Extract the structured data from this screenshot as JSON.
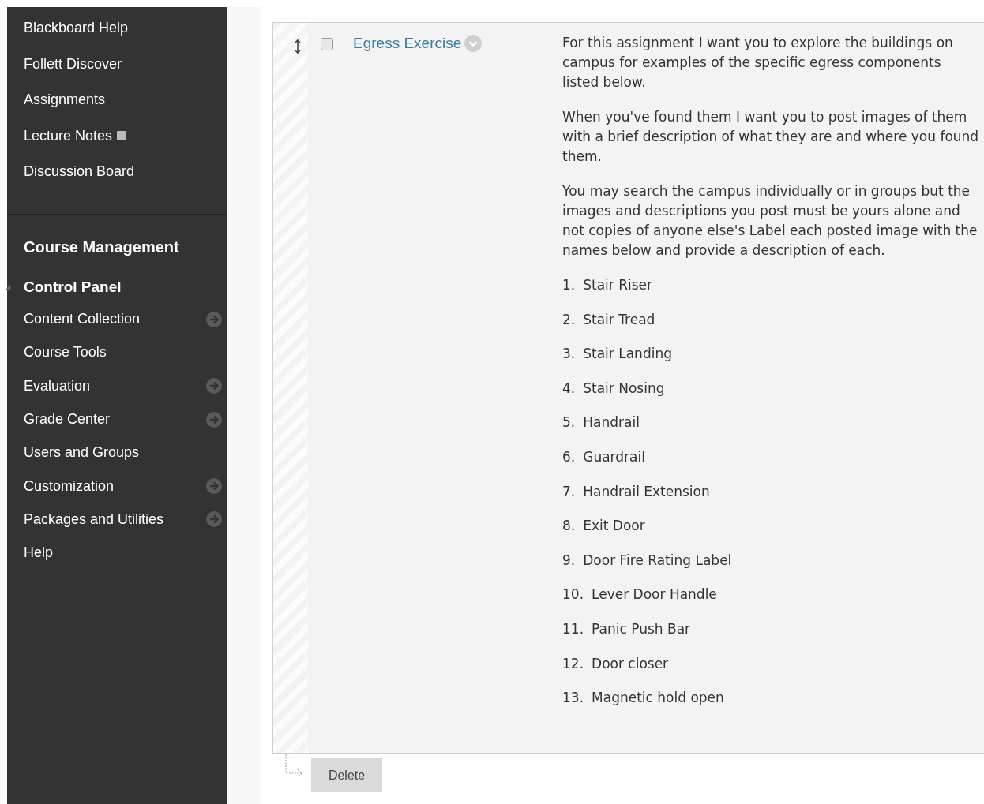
{
  "sidebar": {
    "course_menu": [
      {
        "label": "Blackboard Help",
        "has_icon": false
      },
      {
        "label": "Follett Discover",
        "has_icon": false
      },
      {
        "label": "Assignments",
        "has_icon": false
      },
      {
        "label": "Lecture Notes",
        "has_icon": true
      },
      {
        "label": "Discussion Board",
        "has_icon": false
      }
    ],
    "management_title": "Course Management",
    "control_panel": {
      "label": "Control Panel",
      "expanded": true,
      "items": [
        {
          "label": "Content Collection",
          "has_submenu": true
        },
        {
          "label": "Course Tools",
          "has_submenu": false
        },
        {
          "label": "Evaluation",
          "has_submenu": true
        },
        {
          "label": "Grade Center",
          "has_submenu": true
        },
        {
          "label": "Users and Groups",
          "has_submenu": false
        },
        {
          "label": "Customization",
          "has_submenu": true
        },
        {
          "label": "Packages and Utilities",
          "has_submenu": true
        },
        {
          "label": "Help",
          "has_submenu": false
        }
      ]
    }
  },
  "content": {
    "item": {
      "title": "Egress Exercise",
      "checked": false,
      "paragraphs": [
        "For this assignment I want you to explore the buildings on campus for examples of  the specific egress components listed below.",
        "When you've found them I want you to post images of them with a brief description of what they are and where you found them.",
        "You may search the campus individually or in groups but the images and descriptions you post must be yours alone and not copies of anyone else's Label each posted image with the names below and provide a description of each."
      ],
      "list": [
        {
          "number": "1.",
          "text": "Stair Riser"
        },
        {
          "number": "2.",
          "text": "Stair Tread"
        },
        {
          "number": "3.",
          "text": "Stair Landing"
        },
        {
          "number": "4.",
          "text": "Stair Nosing"
        },
        {
          "number": "5.",
          "text": "Handrail"
        },
        {
          "number": "6.",
          "text": "Guardrail"
        },
        {
          "number": "7.",
          "text": "Handrail Extension"
        },
        {
          "number": "8.",
          "text": "Exit Door"
        },
        {
          "number": "9.",
          "text": "Door Fire Rating Label"
        },
        {
          "number": "10.",
          "text": "Lever Door Handle"
        },
        {
          "number": "11.",
          "text": "Panic Push Bar"
        },
        {
          "number": "12.",
          "text": "Door closer"
        },
        {
          "number": "13.",
          "text": "Magnetic hold open"
        }
      ]
    },
    "actions": [
      "Delete"
    ]
  }
}
